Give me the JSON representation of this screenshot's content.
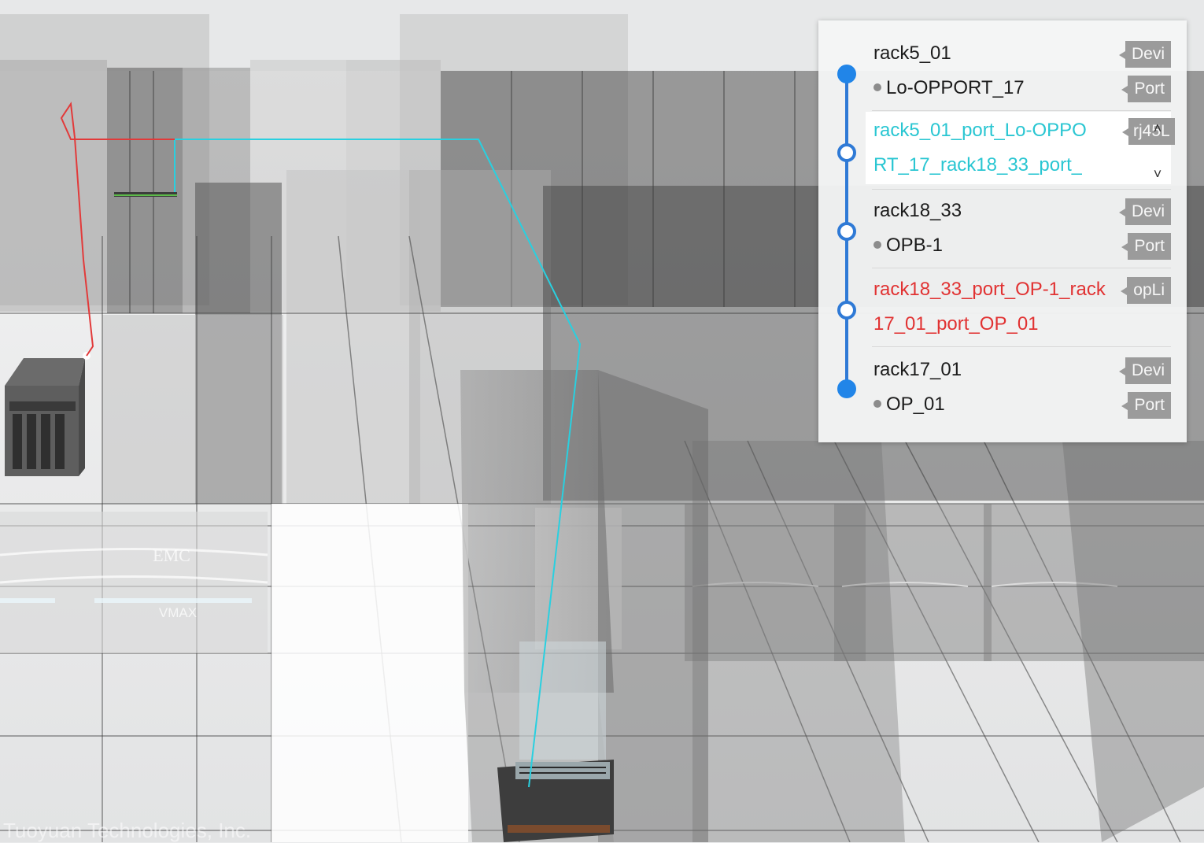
{
  "watermark": "Tuoyuan Technologies, Inc.",
  "brand_labels": {
    "emc": "EMC",
    "vmax": "VMAX"
  },
  "colors": {
    "accent_blue": "#2185e8",
    "link_cyan": "#29c6d2",
    "link_red": "#e13232",
    "tag_gray": "#9b9b9b"
  },
  "path_panel": {
    "items": [
      {
        "device": "rack5_01",
        "device_tag": "Devi",
        "port": "Lo-OPPORT_17",
        "port_tag": "Port",
        "node": "filled"
      },
      {
        "link_line1": "rack5_01_port_Lo-OPPO",
        "link_line2": "RT_17_rack18_33_port_",
        "link_tag": "rj45L",
        "color": "cyan",
        "node": "hollow",
        "scroll_up": "˄",
        "scroll_down": "˅"
      },
      {
        "device": "rack18_33",
        "device_tag": "Devi",
        "port": "OPB-1",
        "port_tag": "Port",
        "node": "hollow"
      },
      {
        "link_line1": "rack18_33_port_OP-1_rack",
        "link_line2": "17_01_port_OP_01",
        "link_tag": "opLi",
        "color": "red",
        "node": "hollow"
      },
      {
        "device": "rack17_01",
        "device_tag": "Devi",
        "port": "OP_01",
        "port_tag": "Port",
        "node": "filled"
      }
    ]
  }
}
